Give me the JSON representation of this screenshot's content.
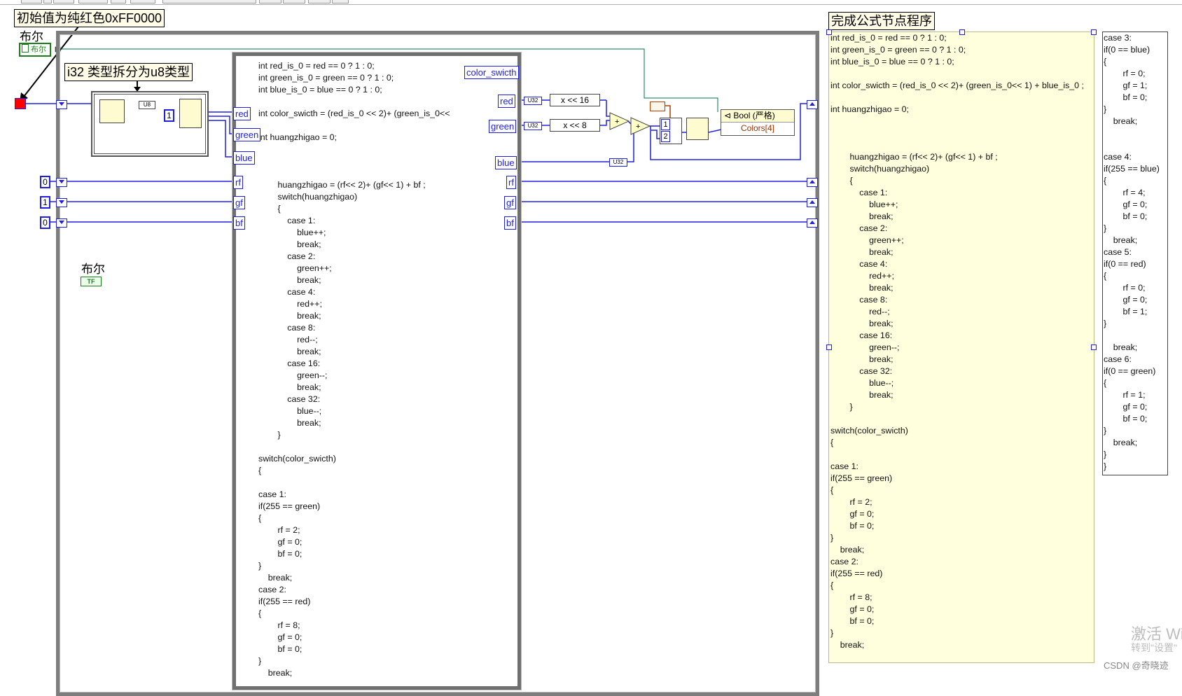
{
  "annotations": {
    "initial_value_note": "初始值为纯红色0xFF0000",
    "split_note": "i32 类型拆分为u8类型",
    "formula_note": "完成公式节点程序"
  },
  "bool_labels": {
    "top_label": "布尔",
    "top_control_text": "布尔",
    "left_label": "布尔",
    "left_indicator_text": "TF"
  },
  "constants": {
    "rf_init": "0",
    "gf_init": "1",
    "bf_init": "0",
    "index_value": "1",
    "build_index_1": "1",
    "build_index_2": "2",
    "shift_16": "x << 16",
    "shift_8": "x << 8",
    "u32_label": "U32",
    "u8_label": "U8"
  },
  "formula_inputs": {
    "red": "red",
    "green": "green",
    "blue": "blue",
    "rf": "rf",
    "gf": "gf",
    "bf": "bf",
    "color_switch": "color_swicth"
  },
  "property_node": {
    "title": "Bool (严格)",
    "property": "Colors[4]"
  },
  "formula_code": "int red_is_0 = red == 0 ? 1 : 0;\nint green_is_0 = green == 0 ? 1 : 0;\nint blue_is_0 = blue == 0 ? 1 : 0;\n\nint color_swicth = (red_is_0 << 2)+ (green_is_0<<\n\nint huangzhigao = 0;\n\n\n\n        huangzhigao = (rf<< 2)+ (gf<< 1) + bf ;\n        switch(huangzhigao)\n        {\n            case 1:\n                blue++;\n                break;\n            case 2:\n                green++;\n                break;\n            case 4:\n                red++;\n                break;\n            case 8:\n                red--;\n                break;\n            case 16:\n                green--;\n                break;\n            case 32:\n                blue--;\n                break;\n        }\n\nswitch(color_swicth)\n{\n\ncase 1:\nif(255 == green)\n{\n        rf = 2;\n        gf = 0;\n        bf = 0;\n}\n    break;\ncase 2:\nif(255 == red)\n{\n        rf = 8;\n        gf = 0;\n        bf = 0;\n}\n    break;",
  "panel_code_main": "int red_is_0 = red == 0 ? 1 : 0;\nint green_is_0 = green == 0 ? 1 : 0;\nint blue_is_0 = blue == 0 ? 1 : 0;\n\nint color_swicth = (red_is_0 << 2)+ (green_is_0<< 1) + blue_is_0 ;\n\nint huangzhigao = 0;\n\n\n\n        huangzhigao = (rf<< 2)+ (gf<< 1) + bf ;\n        switch(huangzhigao)\n        {\n            case 1:\n                blue++;\n                break;\n            case 2:\n                green++;\n                break;\n            case 4:\n                red++;\n                break;\n            case 8:\n                red--;\n                break;\n            case 16:\n                green--;\n                break;\n            case 32:\n                blue--;\n                break;\n        }\n\nswitch(color_swicth)\n{\n\ncase 1:\nif(255 == green)\n{\n        rf = 2;\n        gf = 0;\n        bf = 0;\n}\n    break;\ncase 2:\nif(255 == red)\n{\n        rf = 8;\n        gf = 0;\n        bf = 0;\n}\n    break;",
  "panel_code_side": "case 3:\nif(0 == blue)\n{\n        rf = 0;\n        gf = 1;\n        bf = 0;\n}\n    break;\n\n\ncase 4:\nif(255 == blue)\n{\n        rf = 4;\n        gf = 0;\n        bf = 0;\n}\n    break;\ncase 5:\nif(0 == red)\n{\n        rf = 0;\n        gf = 0;\n        bf = 1;\n}\n\n    break;\ncase 6:\nif(0 == green)\n{\n        rf = 1;\n        gf = 0;\n        bf = 0;\n}\n    break;\n}\n}",
  "watermark": {
    "activate_line1": "激活 Wi",
    "activate_line2": "转到\"设置\"",
    "csdn": "CSDN @奇晓迹"
  },
  "colors": {
    "wire_blue": "#1f1fe0",
    "bool_wire": "#006f4f",
    "loop_gray": "#7d7d7d",
    "yellow_panel": "#ffffde",
    "led_red": "#ff0000"
  }
}
